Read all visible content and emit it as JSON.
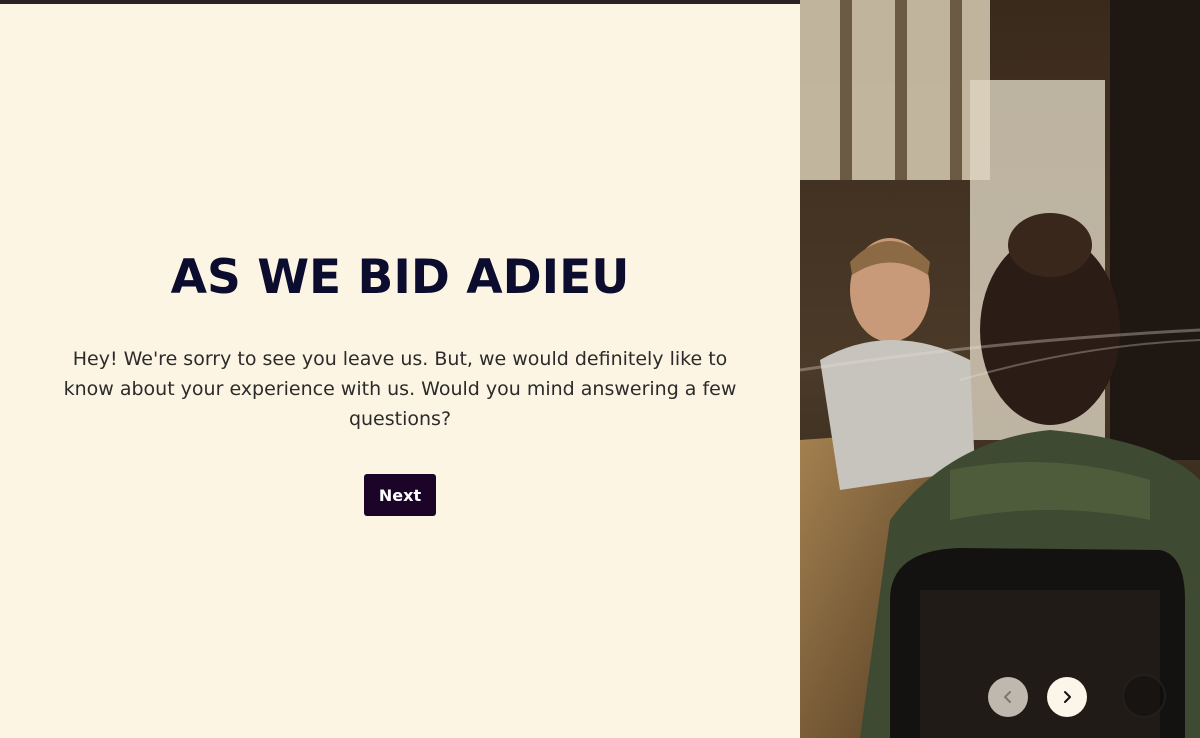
{
  "progress": {
    "fraction": 0.667
  },
  "hero": {
    "title": "AS WE BID ADIEU",
    "description": "Hey! We're sorry to see you leave us⁣. But, we would definitely like to know about your experience with us. Would you mind answering a few questions?",
    "next_label": "Next"
  },
  "carousel": {
    "prev_icon": "chevron-left-icon",
    "next_icon": "chevron-right-icon"
  },
  "colors": {
    "background": "#fdf5e4",
    "title": "#0c0c2e",
    "button": "#1c0428"
  }
}
